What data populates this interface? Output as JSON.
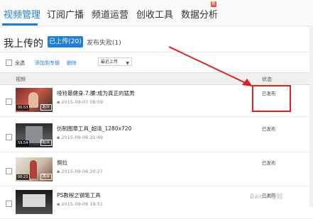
{
  "nav": {
    "tabs": [
      {
        "label": "视频管理"
      },
      {
        "label": "订阅广播"
      },
      {
        "label": "频道运营"
      },
      {
        "label": "创收工具"
      },
      {
        "label": "数据分析"
      }
    ],
    "badge": "新"
  },
  "page_title": "我上传的",
  "status_tabs": {
    "uploaded": "已上传(20)",
    "failed": "发布失败(1)"
  },
  "toolbar": {
    "select_all": "全选",
    "add_to_album": "添加到专辑",
    "delete": "删除",
    "sort": "最近上传"
  },
  "columns": {
    "video": "视频",
    "status": "状态"
  },
  "rows": [
    {
      "title": "哑铃最健身.7.腰:成为真正的猛男",
      "date": "2015-09-07 06:59",
      "status": "已发布",
      "duration": "00:53",
      "badge": "超清"
    },
    {
      "title": "仿制图章工具_超清_1280x720",
      "date": "2015-09-06 21:49",
      "status": "已发布",
      "duration": "59:54",
      "badge": "超清"
    },
    {
      "title": "侧拉",
      "date": "2015-09-06 20:27",
      "status": "已发布",
      "duration": "00:23",
      "badge": "高清"
    },
    {
      "title": "PS教程之钢笔工具",
      "date": "2015-09-06 19:51",
      "status": "已发布",
      "duration": "",
      "badge": ""
    }
  ],
  "watermark": "Baidu 经验",
  "colors": {
    "accent": "#1e7fd6",
    "annotation": "#e02020"
  }
}
